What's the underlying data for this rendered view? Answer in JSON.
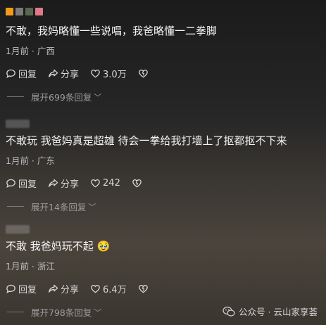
{
  "comments": [
    {
      "text": "不敢，我妈略懂一些说唱，我爸略懂一二拳脚",
      "meta": "1月前 · 广西",
      "reply": "回复",
      "share": "分享",
      "likes": "3.0万",
      "expand": "展开699条回复",
      "avatar_colors": [
        "#f29a1a",
        "#7a7a7a",
        "#5a6650",
        "#e07a8a"
      ]
    },
    {
      "text": "不敢玩 我爸妈真是超雄 待会一拳给我打墙上了抠都抠不下来",
      "meta": "1月前 · 广东",
      "reply": "回复",
      "share": "分享",
      "likes": "242",
      "expand": "展开14条回复"
    },
    {
      "text": "不敢 我爸妈玩不起",
      "emoji": "🥹",
      "meta": "1月前 · 浙江",
      "reply": "回复",
      "share": "分享",
      "likes": "6.4万",
      "expand": "展开798条回复"
    }
  ],
  "watermark": {
    "label": "公众号 · 云山家享荟",
    "icon": "wechat-icon"
  }
}
